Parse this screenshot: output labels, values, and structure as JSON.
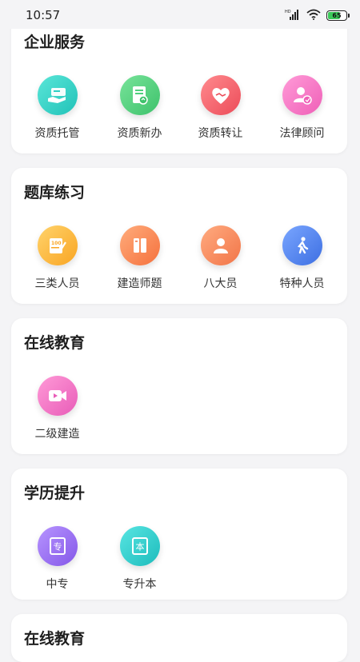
{
  "status_bar": {
    "time": "10:57",
    "battery": "65",
    "network_label": "HD"
  },
  "sections": [
    {
      "title": "企业服务",
      "items": [
        {
          "label": "资质托管",
          "icon": "hand-card-icon",
          "color": "#2ecfc4"
        },
        {
          "label": "资质新办",
          "icon": "document-icon",
          "color": "#4fd07c"
        },
        {
          "label": "资质转让",
          "icon": "handshake-heart-icon",
          "color": "#f2606a"
        },
        {
          "label": "法律顾问",
          "icon": "person-badge-icon",
          "color": "#f57ac6"
        }
      ]
    },
    {
      "title": "题库练习",
      "items": [
        {
          "label": "三类人员",
          "icon": "exam-paper-icon",
          "color": "#fcb23a"
        },
        {
          "label": "建造师题",
          "icon": "books-icon",
          "color": "#fb8a56"
        },
        {
          "label": "八大员",
          "icon": "person-icon",
          "color": "#fb8b5f"
        },
        {
          "label": "特种人员",
          "icon": "walking-person-icon",
          "color": "#4d84ee"
        }
      ]
    },
    {
      "title": "在线教育",
      "items": [
        {
          "label": "二级建造",
          "icon": "video-camera-icon",
          "color": "#f06fc3"
        }
      ]
    },
    {
      "title": "学历提升",
      "items": [
        {
          "label": "中专",
          "icon": "book-zhuan-icon",
          "color": "#9a6ff0",
          "glyph": "专"
        },
        {
          "label": "专升本",
          "icon": "book-ben-icon",
          "color": "#2ccfcf",
          "glyph": "本"
        }
      ]
    },
    {
      "title": "在线教育",
      "items": []
    }
  ]
}
